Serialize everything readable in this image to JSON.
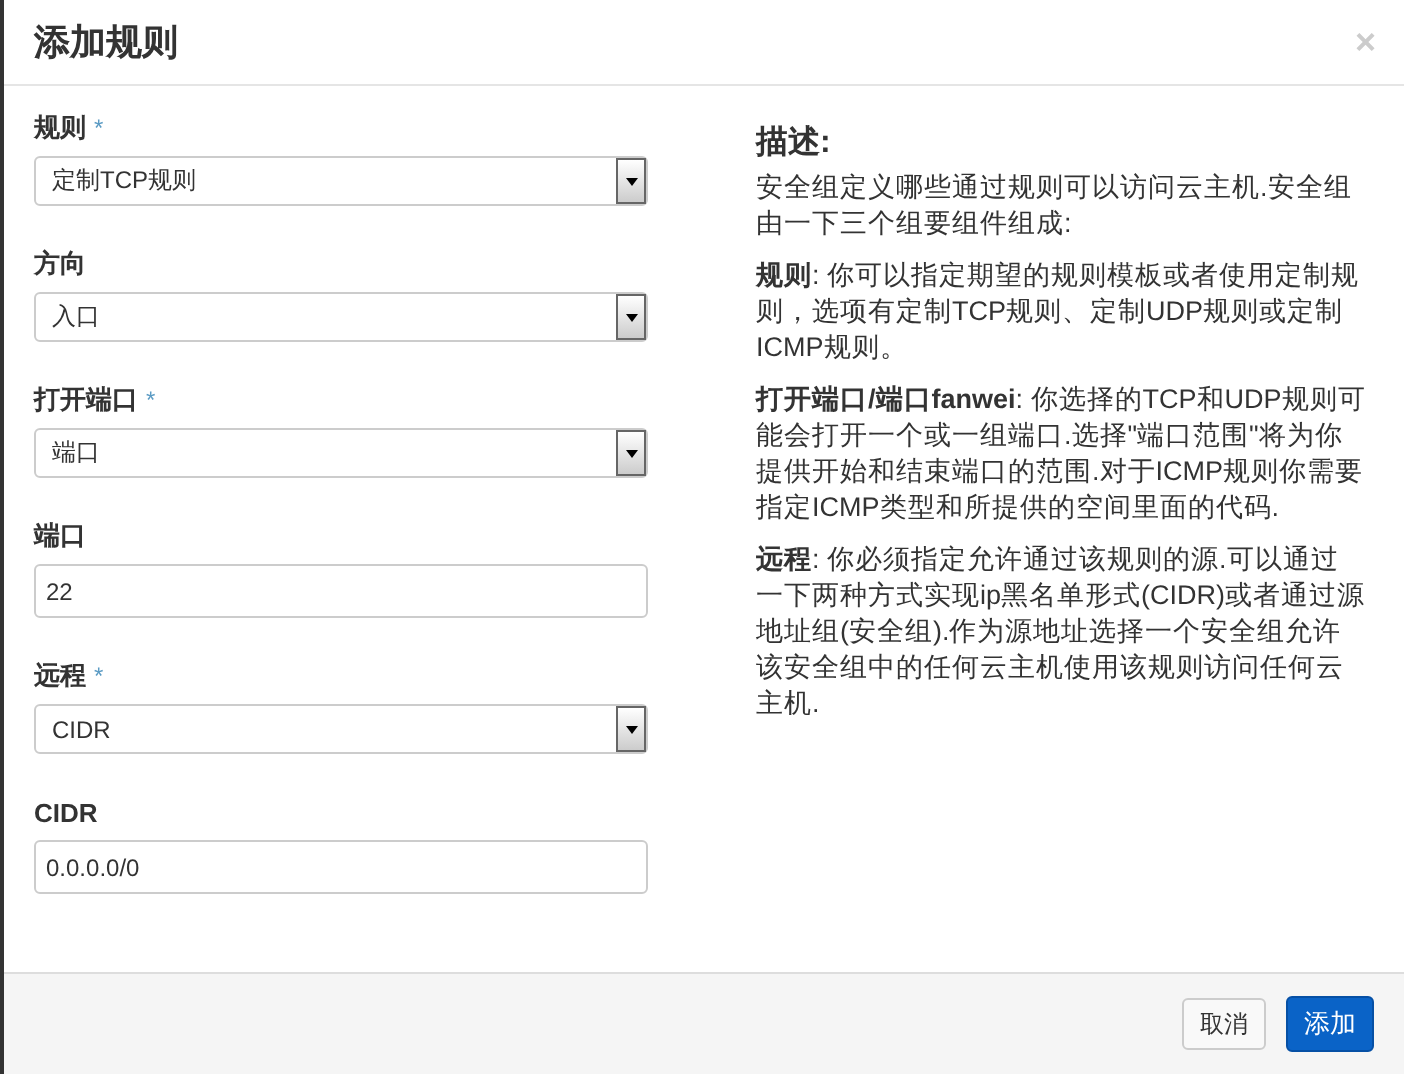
{
  "dialog": {
    "title": "添加规则",
    "close": "×"
  },
  "fields": [
    {
      "kind": "select",
      "label": "规则",
      "required_mark": "*",
      "value": "定制TCP规则"
    },
    {
      "kind": "select",
      "label": "方向",
      "value": "入口"
    },
    {
      "kind": "select",
      "label": "打开端口",
      "required_mark": "*",
      "value": "端口"
    },
    {
      "kind": "text",
      "label": "端口",
      "value": "22"
    },
    {
      "kind": "select",
      "label": "远程",
      "required_mark": "*",
      "value": "CIDR"
    },
    {
      "kind": "text",
      "label": "CIDR",
      "value": "0.0.0.0/0"
    }
  ],
  "description": {
    "heading": "描述:",
    "paragraphs": [
      "安全组定义哪些通过规则可以访问云主机.安全组由一下三个组要组件组成:",
      "**规则**: 你可以指定期望的规则模板或者使用定制规则，选项有定制TCP规则、定制UDP规则或定制ICMP规则。",
      "**打开端口/端口fanwei**: 你选择的TCP和UDP规则可能会打开一个或一组端口.选择\"端口范围\"将为你提供开始和结束端口的范围.对于ICMP规则你需要指定ICMP类型和所提供的空间里面的代码.",
      "**远程**: 你必须指定允许通过该规则的源.可以通过一下两种方式实现ip黑名单形式(CIDR)或者通过源地址组(安全组).作为源地址选择一个安全组允许该安全组中的任何云主机使用该规则访问任何云主机."
    ]
  },
  "buttons": [
    {
      "label": "取消",
      "kind": "secondary"
    },
    {
      "label": "添加",
      "kind": "primary"
    }
  ]
}
